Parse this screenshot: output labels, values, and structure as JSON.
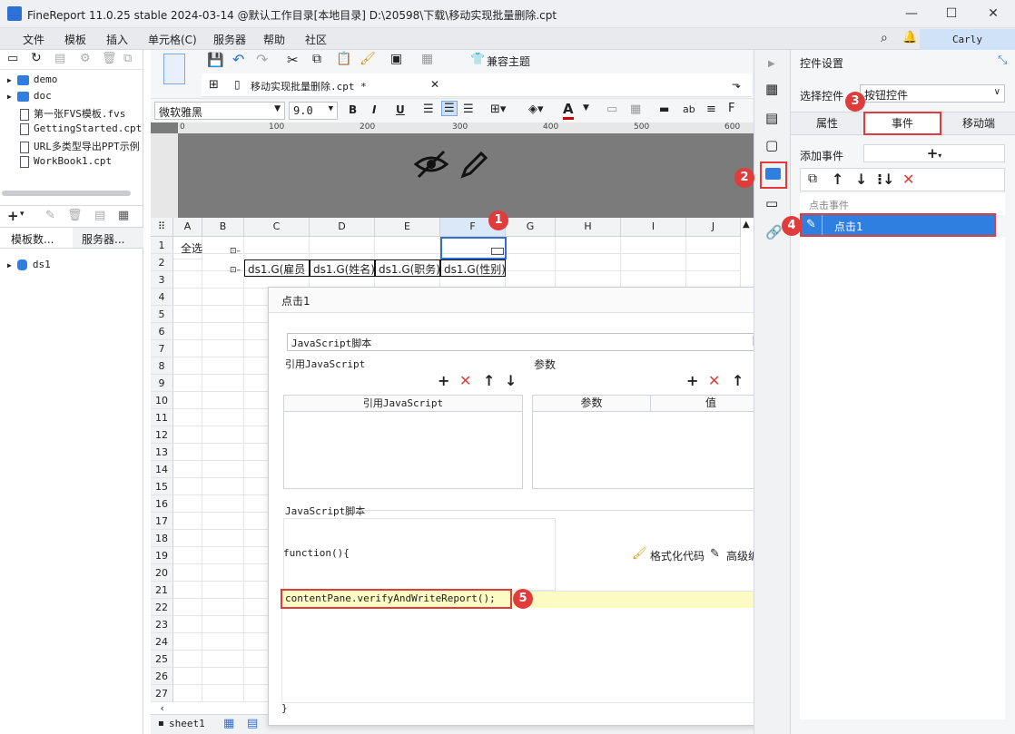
{
  "window": {
    "title": "FineReport 11.0.25 stable 2024-03-14 @默认工作目录[本地目录]   D:\\20598\\下载\\移动实现批量删除.cpt",
    "minimize": "—",
    "maximize": "☐",
    "close": "✕"
  },
  "menu": [
    "文件",
    "模板",
    "插入",
    "单元格(C)",
    "服务器",
    "帮助",
    "社区"
  ],
  "user": "Carly",
  "tree": [
    {
      "label": "demo",
      "type": "folder"
    },
    {
      "label": "doc",
      "type": "folder"
    },
    {
      "label": "第一张FVS模板.fvs",
      "type": "file"
    },
    {
      "label": "GettingStarted.cpt",
      "type": "file"
    },
    {
      "label": "URL多类型导出PPT示例",
      "type": "file"
    },
    {
      "label": "WorkBook1.cpt",
      "type": "file"
    }
  ],
  "left_tabs": [
    "模板数...",
    "服务器..."
  ],
  "dataset": "ds1",
  "toolbar": {
    "theme_label": "兼容主题"
  },
  "file_tab": "移动实现批量删除.cpt *",
  "format": {
    "font": "微软雅黑",
    "size": "9.0"
  },
  "ruler_ticks": [
    "0",
    "100",
    "200",
    "300",
    "400",
    "500",
    "600"
  ],
  "columns": [
    "A",
    "B",
    "C",
    "D",
    "E",
    "F",
    "G",
    "H",
    "I",
    "J"
  ],
  "rows": [
    "1",
    "2",
    "3",
    "4",
    "5",
    "6",
    "7",
    "8",
    "9",
    "10",
    "11",
    "12",
    "13",
    "14",
    "15",
    "16",
    "17",
    "18",
    "19",
    "20",
    "21",
    "22",
    "23",
    "24",
    "25",
    "26",
    "27"
  ],
  "cells": {
    "a1": "全选",
    "c2": "ds1.G(雇员",
    "d2": "ds1.G(姓名)",
    "e2": "ds1.G(职务)",
    "f2": "ds1.G(性别)"
  },
  "sheet": "sheet1",
  "dialog": {
    "title": "点击1",
    "type_select": "JavaScript脚本",
    "ref_js_label": "引用JavaScript",
    "params_label": "参数",
    "ref_js_col": "引用JavaScript",
    "param_col": "参数",
    "value_col": "值",
    "script_label": "JavaScript脚本",
    "func_open": "function(){",
    "format_code": "格式化代码",
    "advanced_edit": "高级编辑",
    "code_line": "contentPane.verifyAndWriteReport();",
    "func_close": "}"
  },
  "right": {
    "title": "控件设置",
    "select_label": "选择控件",
    "select_value": "按钮控件",
    "tabs": [
      "属性",
      "事件",
      "移动端"
    ],
    "add_event": "添加事件",
    "event_group": "点击事件",
    "event_item": "点击1"
  },
  "badges": [
    "1",
    "2",
    "3",
    "4",
    "5"
  ],
  "colors": {
    "accent": "#2f7fe0",
    "highlight": "#e23b3b",
    "code_bg": "#fdfbc4",
    "selected": "#2f7fe0"
  }
}
